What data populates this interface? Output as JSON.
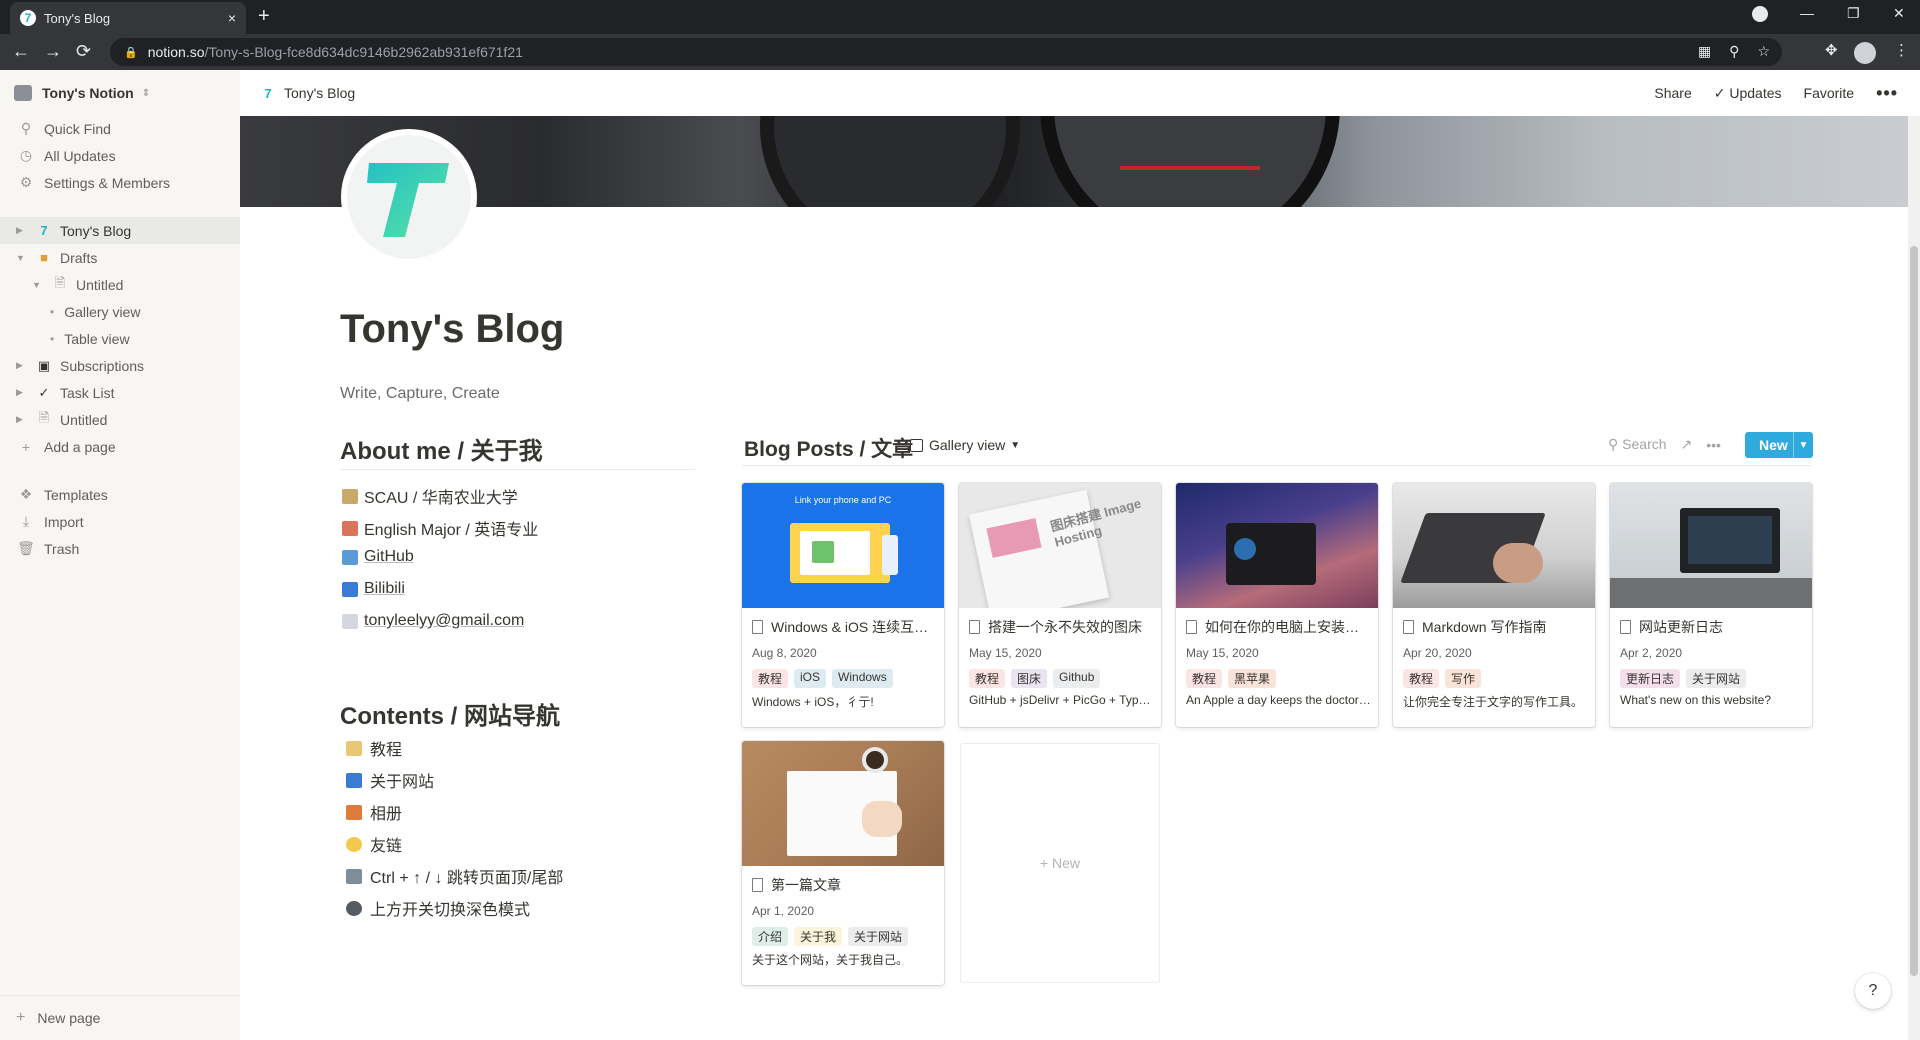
{
  "browser": {
    "tab_title": "Tony's Blog",
    "tab_close": "×",
    "new_tab": "+",
    "url_host": "notion.so",
    "url_path": "/Tony-s-Blog-fce8d634dc9146b2962ab931ef671f21",
    "back": "←",
    "forward": "→",
    "reload": "⟳",
    "minimize": "—",
    "restore": "❐",
    "close": "✕"
  },
  "sidebar": {
    "workspace": "Tony's Notion",
    "menu": [
      {
        "icon": "search-icon",
        "label": "Quick Find"
      },
      {
        "icon": "clock-icon",
        "label": "All Updates"
      },
      {
        "icon": "gear-icon",
        "label": "Settings & Members"
      }
    ],
    "pages": [
      {
        "label": "Tony's Blog"
      },
      {
        "label": "Drafts"
      },
      {
        "label": "Untitled"
      },
      {
        "label": "Gallery view"
      },
      {
        "label": "Table view"
      },
      {
        "label": "Subscriptions"
      },
      {
        "label": "Task List"
      },
      {
        "label": "Untitled"
      },
      {
        "label": "Add a page"
      }
    ],
    "bottom": [
      {
        "label": "Templates"
      },
      {
        "label": "Import"
      },
      {
        "label": "Trash"
      }
    ],
    "new_page": "New page"
  },
  "topbar": {
    "breadcrumb": "Tony's Blog",
    "share": "Share",
    "updates": "Updates",
    "favorite": "Favorite",
    "more": "•••"
  },
  "page": {
    "title": "Tony's Blog",
    "subtitle": "Write, Capture, Create",
    "about_heading": "About me / 关于我",
    "about_items": [
      {
        "label": "SCAU / 华南农业大学",
        "link": false
      },
      {
        "label": "English Major / 英语专业",
        "link": false
      },
      {
        "label": "GitHub",
        "link": true
      },
      {
        "label": "Bilibili",
        "link": true
      },
      {
        "label": "tonyleelyy@gmail.com",
        "link": true
      }
    ],
    "contents_heading": "Contents / 网站导航",
    "contents_items": [
      {
        "label": "教程"
      },
      {
        "label": "关于网站"
      },
      {
        "label": "相册"
      },
      {
        "label": "友链"
      },
      {
        "label": "Ctrl + ↑ / ↓ 跳转页面顶/尾部"
      },
      {
        "label": "上方开关切换深色模式"
      }
    ]
  },
  "gallery": {
    "title": "Blog Posts / 文章",
    "view": "Gallery view",
    "search": "Search",
    "new_button": "New",
    "new_card": "+ New",
    "cards": [
      {
        "title": "Windows & iOS 连续互…",
        "date": "Aug 8, 2020",
        "tags": [
          "教程",
          "iOS",
          "Windows"
        ],
        "desc": "Windows + iOS，彳亍!",
        "image_text": "Link your phone and PC"
      },
      {
        "title": "搭建一个永不失效的图床",
        "date": "May 15, 2020",
        "tags": [
          "教程",
          "图床",
          "Github"
        ],
        "desc": "GitHub + jsDelivr + PicGo + Typ…",
        "image_text": "图床搭建 Image Hosting"
      },
      {
        "title": "如何在你的电脑上安装…",
        "date": "May 15, 2020",
        "tags": [
          "教程",
          "黑苹果"
        ],
        "desc": "An Apple a day keeps the doctor…",
        "image_text": ""
      },
      {
        "title": "Markdown 写作指南",
        "date": "Apr 20, 2020",
        "tags": [
          "教程",
          "写作"
        ],
        "desc": "让你完全专注于文字的写作工具。",
        "image_text": ""
      },
      {
        "title": "网站更新日志",
        "date": "Apr 2, 2020",
        "tags": [
          "更新日志",
          "关于网站"
        ],
        "desc": "What's new on this website?",
        "image_text": ""
      },
      {
        "title": "第一篇文章",
        "date": "Apr 1, 2020",
        "tags": [
          "介绍",
          "关于我",
          "关于网站"
        ],
        "desc": "关于这个网站，关于我自己。",
        "image_text": ""
      }
    ]
  },
  "help": "?"
}
